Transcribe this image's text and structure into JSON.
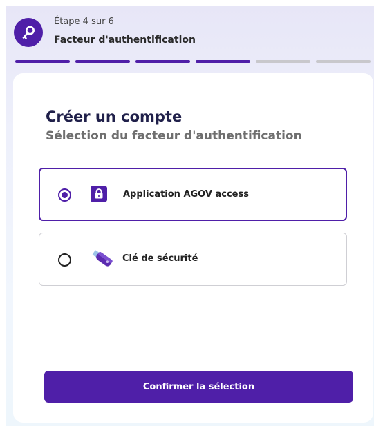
{
  "header": {
    "step_label": "Étape 4 sur 6",
    "step_title": "Facteur d'authentification",
    "step_icon": "key-icon",
    "progress": {
      "current": 4,
      "total": 6
    }
  },
  "card": {
    "title": "Créer un compte",
    "subtitle": "Sélection du facteur d'authentification",
    "options": [
      {
        "label": "Application AGOV access",
        "icon": "lock-app-icon",
        "selected": true
      },
      {
        "label": "Clé de sécurité",
        "icon": "usb-key-icon",
        "selected": false
      }
    ],
    "confirm_label": "Confirmer la sélection"
  },
  "colors": {
    "accent": "#4f1fa8",
    "progress_inactive": "#c8c8cc"
  }
}
